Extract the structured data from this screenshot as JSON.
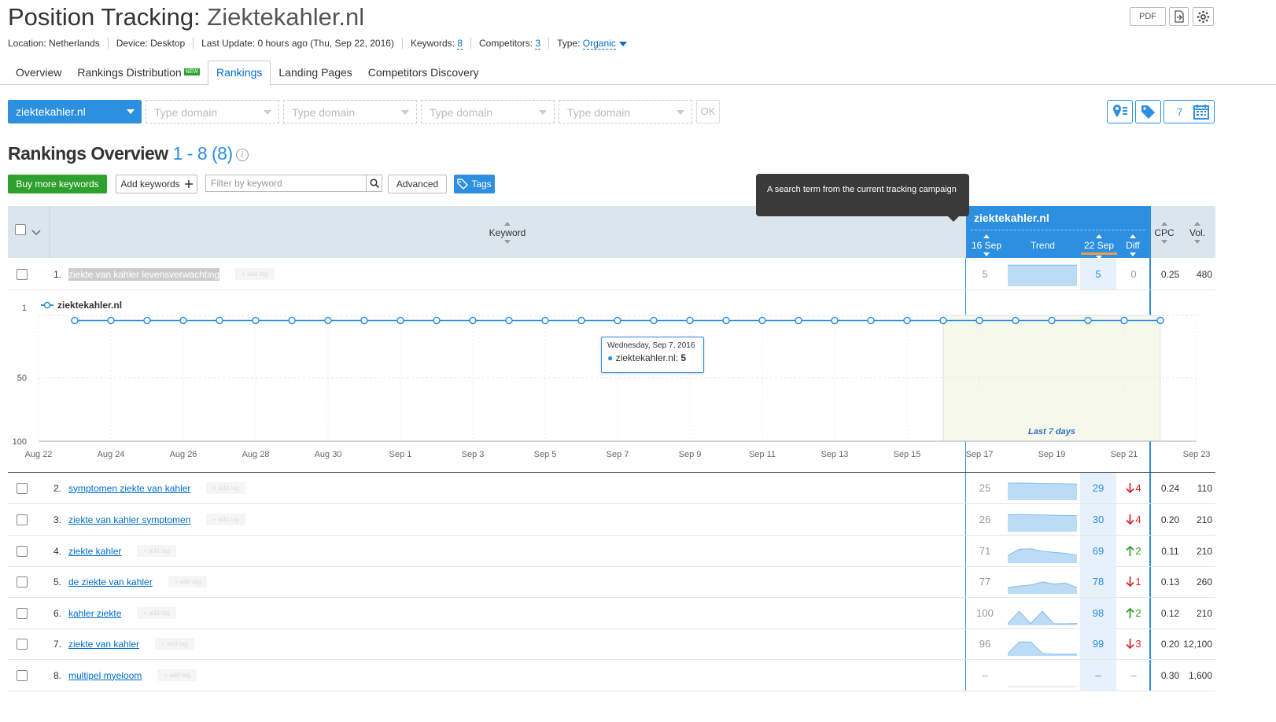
{
  "header": {
    "title_prefix": "Position Tracking:",
    "title_domain": "Ziektekahler.nl",
    "location": "Location: Netherlands",
    "device": "Device: Desktop",
    "last_update": "Last Update: 0 hours ago (Thu, Sep 22, 2016)",
    "keywords_label": "Keywords:",
    "keywords_count": "8",
    "competitors_label": "Competitors:",
    "competitors_count": "3",
    "type_label": "Type:",
    "type_value": "Organic",
    "pdf_label": "PDF"
  },
  "tabs": [
    {
      "label": "Overview",
      "active": false
    },
    {
      "label": "Rankings Distribution",
      "badge": "NEW",
      "active": false
    },
    {
      "label": "Rankings",
      "active": true
    },
    {
      "label": "Landing Pages",
      "active": false
    },
    {
      "label": "Competitors Discovery",
      "active": false
    }
  ],
  "domains": {
    "main": "ziektekahler.nl",
    "placeholder": "Type domain",
    "ok": "OK",
    "days": "7"
  },
  "overview": {
    "title": "Rankings Overview",
    "range": "1 - 8 (8)",
    "info": "i"
  },
  "toolbar": {
    "buy": "Buy more keywords",
    "add": "Add keywords",
    "filter_placeholder": "Filter by keyword",
    "advanced": "Advanced",
    "tags": "Tags"
  },
  "tooltip": "A search term from the current tracking campaign",
  "table_head": {
    "keyword": "Keyword",
    "domain": "ziektekahler.nl",
    "date_old": "16 Sep",
    "trend": "Trend",
    "date_new": "22 Sep",
    "diff": "Diff",
    "cpc": "CPC",
    "vol": "Vol."
  },
  "add_tag": "+ add tag",
  "rows": [
    {
      "num": "1.",
      "keyword": "ziekte van kahler levensverwachting",
      "old": "5",
      "new": "5",
      "diff": "0",
      "dir": "zero",
      "cpc": "0.25",
      "vol": "480",
      "trend": [
        5,
        5,
        5,
        5,
        5,
        5,
        5
      ]
    },
    {
      "num": "2.",
      "keyword": "symptomen ziekte van kahler",
      "old": "25",
      "new": "29",
      "diff": "4",
      "dir": "down",
      "cpc": "0.24",
      "vol": "110",
      "trend": [
        25,
        24,
        25,
        26,
        27,
        28,
        29
      ]
    },
    {
      "num": "3.",
      "keyword": "ziekte van kahler symptomen",
      "old": "26",
      "new": "30",
      "diff": "4",
      "dir": "down",
      "cpc": "0.20",
      "vol": "210",
      "trend": [
        26,
        25,
        26,
        27,
        28,
        29,
        30
      ]
    },
    {
      "num": "4.",
      "keyword": "ziekte kahler",
      "old": "71",
      "new": "69",
      "diff": "2",
      "dir": "up",
      "cpc": "0.11",
      "vol": "210",
      "trend": [
        71,
        40,
        38,
        50,
        55,
        60,
        69
      ]
    },
    {
      "num": "5.",
      "keyword": "de ziekte van kahler",
      "old": "77",
      "new": "78",
      "diff": "1",
      "dir": "down",
      "cpc": "0.13",
      "vol": "260",
      "trend": [
        77,
        70,
        65,
        50,
        60,
        55,
        78
      ]
    },
    {
      "num": "6.",
      "keyword": "kahler ziekte",
      "old": "100",
      "new": "98",
      "diff": "2",
      "dir": "up",
      "cpc": "0.12",
      "vol": "210",
      "trend": [
        100,
        40,
        100,
        40,
        100,
        100,
        98
      ]
    },
    {
      "num": "7.",
      "keyword": "ziekte van kahler",
      "old": "96",
      "new": "99",
      "diff": "3",
      "dir": "down",
      "cpc": "0.20",
      "vol": "12,100",
      "trend": [
        96,
        40,
        40,
        95,
        99,
        99,
        99
      ]
    },
    {
      "num": "8.",
      "keyword": "multipel myeloom",
      "old": "–",
      "new": "–",
      "diff": "–",
      "dir": "zero",
      "cpc": "0.30",
      "vol": "1,600",
      "trend": []
    }
  ],
  "chart_data": {
    "type": "line",
    "legend": "ziektekahler.nl",
    "x_labels": [
      "Aug 22",
      "Aug 24",
      "Aug 26",
      "Aug 28",
      "Aug 30",
      "Sep 1",
      "Sep 3",
      "Sep 5",
      "Sep 7",
      "Sep 9",
      "Sep 11",
      "Sep 13",
      "Sep 15",
      "Sep 17",
      "Sep 19",
      "Sep 21",
      "Sep 23"
    ],
    "x": [
      "Aug 23",
      "Aug 24",
      "Aug 25",
      "Aug 26",
      "Aug 27",
      "Aug 28",
      "Aug 29",
      "Aug 30",
      "Aug 31",
      "Sep 1",
      "Sep 2",
      "Sep 3",
      "Sep 4",
      "Sep 5",
      "Sep 6",
      "Sep 7",
      "Sep 8",
      "Sep 9",
      "Sep 10",
      "Sep 11",
      "Sep 12",
      "Sep 13",
      "Sep 14",
      "Sep 15",
      "Sep 16",
      "Sep 17",
      "Sep 18",
      "Sep 19",
      "Sep 20",
      "Sep 21",
      "Sep 22"
    ],
    "series": [
      {
        "name": "ziektekahler.nl",
        "values": [
          5,
          5,
          5,
          5,
          5,
          5,
          5,
          5,
          5,
          5,
          5,
          5,
          5,
          5,
          5,
          5,
          5,
          5,
          5,
          5,
          5,
          5,
          5,
          5,
          5,
          5,
          5,
          5,
          5,
          5,
          5
        ]
      }
    ],
    "y_ticks": [
      "1",
      "50",
      "100"
    ],
    "ylim": [
      1,
      100
    ],
    "y_reversed": true,
    "highlight_label": "Last 7 days",
    "tooltip_date": "Wednesday, Sep 7, 2016",
    "tooltip_series": "ziektekahler.nl:",
    "tooltip_value": "5"
  }
}
